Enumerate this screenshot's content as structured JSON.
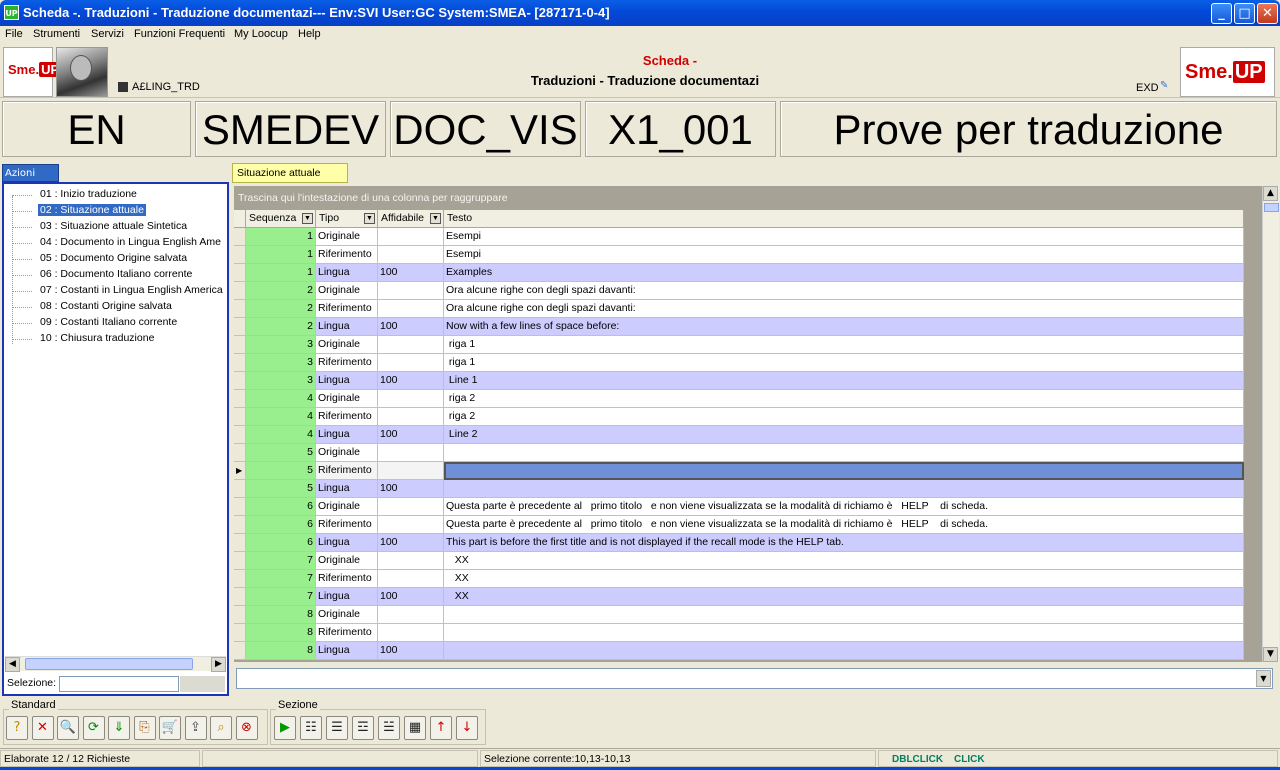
{
  "window": {
    "title": "Scheda -. Traduzioni - Traduzione documentazi--- Env:SVI User:GC System:SMEA- [287171-0-4]",
    "app_icon": "UP",
    "minimize": "_",
    "maximize": "□",
    "close": "✕"
  },
  "menu": [
    "File",
    "Strumenti",
    "Servizi",
    "Funzioni Frequenti",
    "My Loocup",
    "Help"
  ],
  "header": {
    "logo_left": "Sme.",
    "logo_left_up": "UP",
    "user_code": "A£LING_TRD",
    "scheda_label": "Scheda -",
    "scheda_title": "Traduzioni - Traduzione documentazi",
    "exd": "EXD",
    "logo_right": "Sme.",
    "logo_right_up": "UP"
  },
  "keys": [
    "EN",
    "SMEDEV",
    "DOC_VIS",
    "X1_001",
    "Prove per traduzione"
  ],
  "azioni": {
    "tab": "Azioni",
    "items": [
      "01 : Inizio traduzione",
      "02 : Situazione attuale",
      "03 : Situazione attuale Sintetica",
      "04 : Documento in Lingua English Ame",
      "05 : Documento Origine salvata",
      "06 : Documento Italiano corrente",
      "07 : Costanti in Lingua English America",
      "08 : Costanti Origine salvata",
      "09 : Costanti Italiano corrente",
      "10 : Chiusura traduzione"
    ],
    "selected_index": 1,
    "selezione_label": "Selezione:",
    "selezione_value": ""
  },
  "grid": {
    "tab": "Situazione attuale",
    "group_hint": "Trascina qui l'intestazione di una colonna per raggruppare",
    "columns": [
      "Sequenza",
      "Tipo",
      "Affidabile",
      "Testo"
    ],
    "current_row": 13,
    "rows": [
      [
        "1",
        "Originale",
        "",
        "Esempi"
      ],
      [
        "1",
        "Riferimento",
        "",
        "Esempi"
      ],
      [
        "1",
        "Lingua",
        "100",
        "Examples"
      ],
      [
        "2",
        "Originale",
        "",
        "Ora alcune righe con degli spazi davanti:"
      ],
      [
        "2",
        "Riferimento",
        "",
        "Ora alcune righe con degli spazi davanti:"
      ],
      [
        "2",
        "Lingua",
        "100",
        "Now with a few lines of space before:"
      ],
      [
        "3",
        "Originale",
        "",
        " riga 1"
      ],
      [
        "3",
        "Riferimento",
        "",
        " riga 1"
      ],
      [
        "3",
        "Lingua",
        "100",
        " Line 1"
      ],
      [
        "4",
        "Originale",
        "",
        " riga 2"
      ],
      [
        "4",
        "Riferimento",
        "",
        " riga 2"
      ],
      [
        "4",
        "Lingua",
        "100",
        " Line 2"
      ],
      [
        "5",
        "Originale",
        "",
        ""
      ],
      [
        "5",
        "Riferimento",
        "",
        ""
      ],
      [
        "5",
        "Lingua",
        "100",
        ""
      ],
      [
        "6",
        "Originale",
        "",
        "Questa parte è precedente al   primo titolo   e non viene visualizzata se la modalità di richiamo è   HELP    di scheda."
      ],
      [
        "6",
        "Riferimento",
        "",
        "Questa parte è precedente al   primo titolo   e non viene visualizzata se la modalità di richiamo è   HELP    di scheda."
      ],
      [
        "6",
        "Lingua",
        "100",
        "This part is before the first title and is not displayed if the recall mode is the HELP tab."
      ],
      [
        "7",
        "Originale",
        "",
        "   XX"
      ],
      [
        "7",
        "Riferimento",
        "",
        "   XX"
      ],
      [
        "7",
        "Lingua",
        "100",
        "   XX"
      ],
      [
        "8",
        "Originale",
        "",
        ""
      ],
      [
        "8",
        "Riferimento",
        "",
        ""
      ],
      [
        "8",
        "Lingua",
        "100",
        ""
      ]
    ]
  },
  "toolbar": {
    "standard_label": "Standard",
    "sezione_label": "Sezione",
    "standard_icons": [
      {
        "name": "help-icon",
        "glyph": "?"
      },
      {
        "name": "close-x-icon",
        "glyph": "✕"
      },
      {
        "name": "magnifier-icon",
        "glyph": "🔍"
      },
      {
        "name": "refresh-icon",
        "glyph": "⟳"
      },
      {
        "name": "down-arrow-icon",
        "glyph": "⇓"
      },
      {
        "name": "export-icon",
        "glyph": "⎘"
      },
      {
        "name": "cart-icon",
        "glyph": "🛒"
      },
      {
        "name": "upload-icon",
        "glyph": "⇪"
      },
      {
        "name": "search-zoom-icon",
        "glyph": "⌕"
      },
      {
        "name": "stop-icon",
        "glyph": "⊗"
      }
    ],
    "sezione_icons": [
      {
        "name": "play-icon",
        "glyph": "▶"
      },
      {
        "name": "tree-icon",
        "glyph": "☷"
      },
      {
        "name": "columns-icon",
        "glyph": "☰"
      },
      {
        "name": "tree-add-icon",
        "glyph": "☲"
      },
      {
        "name": "tree-level-icon",
        "glyph": "☱"
      },
      {
        "name": "grid-icon",
        "glyph": "▦"
      },
      {
        "name": "move-up-icon",
        "glyph": "↑"
      },
      {
        "name": "move-down-icon",
        "glyph": "↓"
      }
    ]
  },
  "status": {
    "left": "Elaborate 12 / 12 Richieste",
    "middle": "Selezione corrente:10,13-10,13",
    "dblclick": "DBLCLICK",
    "click": "CLICK"
  },
  "colors": {
    "title_bar": "#0349d8",
    "sequence_cell": "#99ef8e",
    "lingua_row": "#ccccff",
    "selected_row": "#6f8fd6",
    "accent_red": "#d00000"
  }
}
